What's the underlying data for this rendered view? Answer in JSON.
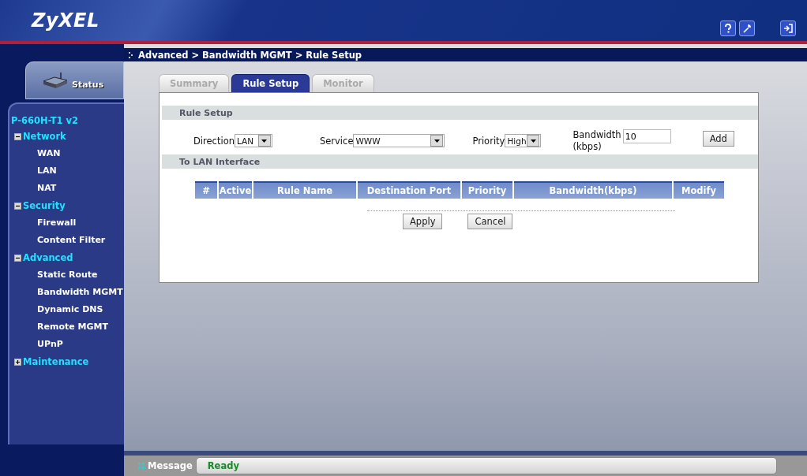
{
  "header": {
    "logo": "ZyXEL"
  },
  "sidebar": {
    "status_tab": "Status",
    "device": "P-660H-T1 v2",
    "tree": [
      {
        "label": "Network",
        "expanded": true,
        "children": [
          {
            "label": "WAN"
          },
          {
            "label": "LAN"
          },
          {
            "label": "NAT"
          }
        ]
      },
      {
        "label": "Security",
        "expanded": true,
        "children": [
          {
            "label": "Firewall"
          },
          {
            "label": "Content Filter"
          }
        ]
      },
      {
        "label": "Advanced",
        "expanded": true,
        "children": [
          {
            "label": "Static Route"
          },
          {
            "label": "Bandwidth MGMT"
          },
          {
            "label": "Dynamic DNS"
          },
          {
            "label": "Remote MGMT"
          },
          {
            "label": "UPnP"
          }
        ]
      },
      {
        "label": "Maintenance",
        "expanded": false
      }
    ]
  },
  "breadcrumb": "Advanced > Bandwidth MGMT > Rule Setup",
  "tabs": [
    {
      "label": "Summary",
      "selected": false
    },
    {
      "label": "Rule Setup",
      "selected": true
    },
    {
      "label": "Monitor",
      "selected": false
    }
  ],
  "rule_setup": {
    "title": "Rule Setup",
    "direction": {
      "label": "Direction",
      "value": "LAN"
    },
    "service": {
      "label": "Service",
      "value": "WWW"
    },
    "priority": {
      "label": "Priority",
      "value": "High"
    },
    "bandwidth": {
      "label": "Bandwidth",
      "unit": "(kbps)",
      "value": "10"
    },
    "add": "Add"
  },
  "table": {
    "title": "To LAN Interface",
    "columns": [
      "#",
      "Active",
      "Rule Name",
      "Destination Port",
      "Priority",
      "Bandwidth(kbps)",
      "Modify"
    ]
  },
  "buttons": [
    "Apply",
    "Cancel"
  ],
  "status_bar": {
    "label": "Message",
    "value": "Ready"
  }
}
